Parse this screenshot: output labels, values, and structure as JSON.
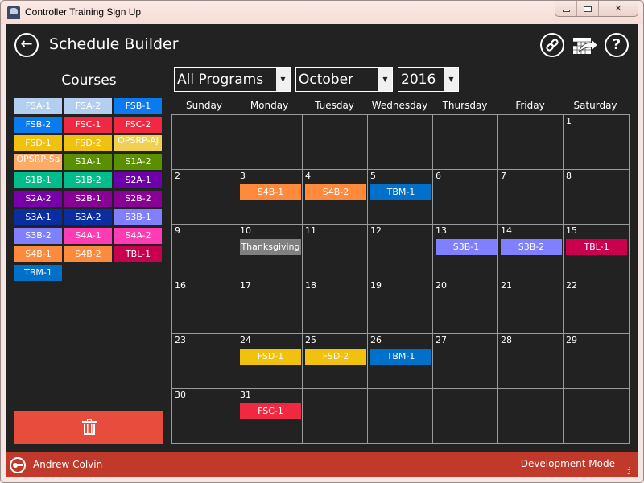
{
  "window": {
    "title": "Controller Training Sign Up",
    "app_icon_label": "CTSU",
    "controls": {
      "minimize": "minimize",
      "maximize": "maximize",
      "close": "✕"
    }
  },
  "header": {
    "back_icon": "←",
    "title": "Schedule Builder",
    "link_icon": "🔗",
    "help_icon": "?"
  },
  "sidebar": {
    "title": "Courses",
    "courses": [
      {
        "label": "FSA-1",
        "color": "#b4cef0"
      },
      {
        "label": "FSA-2",
        "color": "#b4cef0"
      },
      {
        "label": "FSB-1",
        "color": "#0a7af0"
      },
      {
        "label": "FSB-2",
        "color": "#0a7af0"
      },
      {
        "label": "FSC-1",
        "color": "#f02841"
      },
      {
        "label": "FSC-2",
        "color": "#f02841"
      },
      {
        "label": "FSD-1",
        "color": "#f0c20f"
      },
      {
        "label": "FSD-2",
        "color": "#f0c20f"
      },
      {
        "label": "OPSRP-Aj",
        "color": "#f0d050",
        "top": true
      },
      {
        "label": "OPSRP-Sa",
        "color": "#ffaa66",
        "top": true
      },
      {
        "label": "S1A-1",
        "color": "#5a8f00"
      },
      {
        "label": "S1A-2",
        "color": "#5a8f00"
      },
      {
        "label": "S1B-1",
        "color": "#00be8c"
      },
      {
        "label": "S1B-2",
        "color": "#00be8c"
      },
      {
        "label": "S2A-1",
        "color": "#6e00aa"
      },
      {
        "label": "S2A-2",
        "color": "#7800aa"
      },
      {
        "label": "S2B-1",
        "color": "#880096"
      },
      {
        "label": "S2B-2",
        "color": "#880096"
      },
      {
        "label": "S3A-1",
        "color": "#0a2ea0"
      },
      {
        "label": "S3A-2",
        "color": "#0a2ea0"
      },
      {
        "label": "S3B-1",
        "color": "#8080ff"
      },
      {
        "label": "S3B-2",
        "color": "#8080ff"
      },
      {
        "label": "S4A-1",
        "color": "#ff3cb4"
      },
      {
        "label": "S4A-2",
        "color": "#ff3cb4"
      },
      {
        "label": "S4B-1",
        "color": "#ff8a3c"
      },
      {
        "label": "S4B-2",
        "color": "#ff8a3c"
      },
      {
        "label": "TBL-1",
        "color": "#c8004e"
      },
      {
        "label": "TBM-1",
        "color": "#0070c8"
      }
    ],
    "delete_icon": "trash-icon"
  },
  "filters": {
    "program": "All Programs",
    "month": "October",
    "year": "2016",
    "arrow": "▼"
  },
  "calendar": {
    "days": [
      "Sunday",
      "Monday",
      "Tuesday",
      "Wednesday",
      "Thursday",
      "Friday",
      "Saturday"
    ],
    "first_weekday": 6,
    "num_days": 31,
    "events": [
      {
        "day": 3,
        "label": "S4B-1",
        "color": "#ff8a3c"
      },
      {
        "day": 4,
        "label": "S4B-2",
        "color": "#ff8a3c"
      },
      {
        "day": 5,
        "label": "TBM-1",
        "color": "#0070c8"
      },
      {
        "day": 10,
        "label": "Thanksgiving",
        "color": "#808080"
      },
      {
        "day": 13,
        "label": "S3B-1",
        "color": "#8080ff"
      },
      {
        "day": 14,
        "label": "S3B-2",
        "color": "#8080ff"
      },
      {
        "day": 15,
        "label": "TBL-1",
        "color": "#c8004e"
      },
      {
        "day": 24,
        "label": "FSD-1",
        "color": "#f0c20f"
      },
      {
        "day": 25,
        "label": "FSD-2",
        "color": "#f0c20f"
      },
      {
        "day": 26,
        "label": "TBM-1",
        "color": "#0070c8"
      },
      {
        "day": 31,
        "label": "FSC-1",
        "color": "#f02841"
      }
    ]
  },
  "status": {
    "user": "Andrew Colvin",
    "mode": "Development Mode"
  }
}
